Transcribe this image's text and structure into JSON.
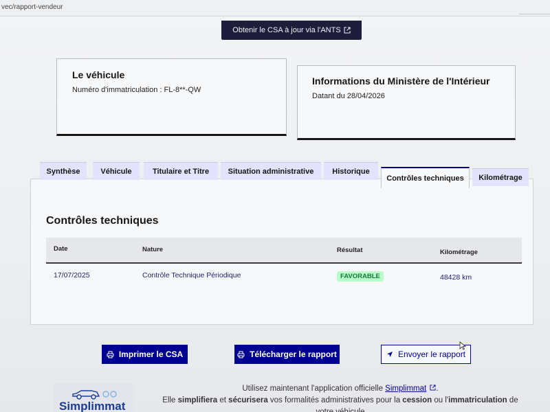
{
  "browser": {
    "url_text": "vec/rapport-vendeur"
  },
  "csa_banner": {
    "label": "Obtenir le CSA à jour via l'ANTS",
    "icon": "external-link-icon"
  },
  "vehicle_card": {
    "title": "Le véhicule",
    "plate_line": "Numéro d'immatriculation : FL-8**-QW"
  },
  "ministry_card": {
    "title": "Informations du Ministère de l'Intérieur",
    "date_line": "Datant du 28/04/2026"
  },
  "tabs": [
    {
      "label": "Synthèse",
      "active": false
    },
    {
      "label": "Véhicule",
      "active": false
    },
    {
      "label": "Titulaire et Titre",
      "active": false
    },
    {
      "label": "Situation administrative",
      "active": false
    },
    {
      "label": "Historique",
      "active": false
    },
    {
      "label": "Contrôles techniques",
      "active": true
    },
    {
      "label": "Kilométrage",
      "active": false
    }
  ],
  "panel": {
    "title": "Contrôles techniques",
    "columns": [
      "Date",
      "Nature",
      "Résultat",
      "Kilométrage"
    ],
    "rows": [
      {
        "date": "17/07/2025",
        "nature": "Contrôle Technique Périodique",
        "result": "FAVORABLE",
        "km": "48428 km"
      }
    ]
  },
  "actions": {
    "print_label": "Imprimer le CSA",
    "download_label": "Télécharger le rapport",
    "send_label": "Envoyer le rapport"
  },
  "footer": {
    "logo_text": "Simplimmat",
    "line1_prefix": "Utilisez maintenant l'application officielle ",
    "line1_link": "Simplimmat",
    "line1_suffix": ".",
    "line2_a": "Elle ",
    "line2_b": "simplifiera",
    "line2_c": " et ",
    "line2_d": "sécurisera",
    "line2_e": " vos formalités administratives pour la ",
    "line2_f": "cession",
    "line2_g": " ou l'",
    "line2_h": "immatriculation",
    "line2_i": " de",
    "line3": "votre véhicule"
  },
  "colors": {
    "brand_blue": "#000091",
    "tab_bg": "#e3e3fd",
    "badge_bg": "#b8fec9",
    "badge_text": "#18753c",
    "banner_bg": "#1e1e3c"
  }
}
